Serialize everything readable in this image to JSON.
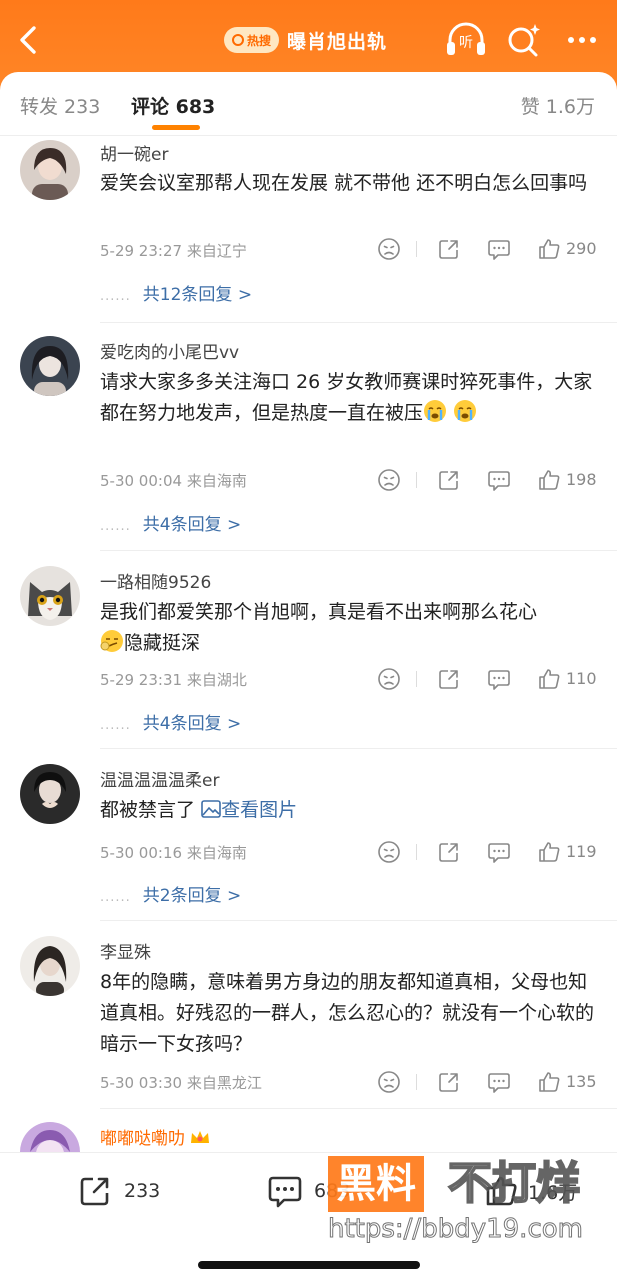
{
  "header": {
    "hot_badge": "热搜",
    "title": "曝肖旭出轨",
    "listen_label": "听",
    "icons": [
      "back-icon",
      "headphones-icon",
      "ai-search-icon",
      "more-icon"
    ],
    "bg_color": "#ff7a1a"
  },
  "tabs": {
    "repost": "转发 233",
    "comment": "评论 683",
    "like": "赞 1.6万",
    "accent_color": "#ff8200"
  },
  "comments": [
    {
      "name": "胡一碗er",
      "text": "爱笑会议室那帮人现在发展  就不带他  还不明白怎么回事吗",
      "time": "5-29 23:27",
      "location": "来自辽宁",
      "likes": "290",
      "replies": "共12条回复 >"
    },
    {
      "name": "爱吃肉的小尾巴vv",
      "text": "请求大家多多关注海口 26 岁女教师赛课时猝死事件，大家都在努力地发声，但是热度一直在被压",
      "time": "5-30 00:04",
      "location": "来自海南",
      "likes": "198",
      "replies": "共4条回复 >"
    },
    {
      "name": "一路相随9526",
      "text": "是我们都爱笑那个肖旭啊，真是看不出来啊那么花心",
      "text_after": "隐藏挺深",
      "time": "5-29 23:31",
      "location": "来自湖北",
      "likes": "110",
      "replies": "共4条回复 >"
    },
    {
      "name": "温温温温温柔er",
      "text": "都被禁言了",
      "image_link": "查看图片",
      "time": "5-30 00:16",
      "location": "来自海南",
      "likes": "119",
      "replies": "共2条回复 >"
    },
    {
      "name": "李显殊",
      "text": "8年的隐瞒，意味着男方身边的朋友都知道真相，父母也知道真相。好残忍的一群人，怎么忍心的？就没有一个心软的暗示一下女孩吗？",
      "time": "5-30 03:30",
      "location": "来自黑龙江",
      "likes": "135"
    },
    {
      "name": "嘟嘟哒嘞叻"
    }
  ],
  "bottom_bar": {
    "repost": "233",
    "comment": "683",
    "like": "1.6万"
  },
  "watermark": {
    "brand_box": "黑料",
    "brand_rest": "不打烊",
    "url": "https://bbdy19.com"
  }
}
